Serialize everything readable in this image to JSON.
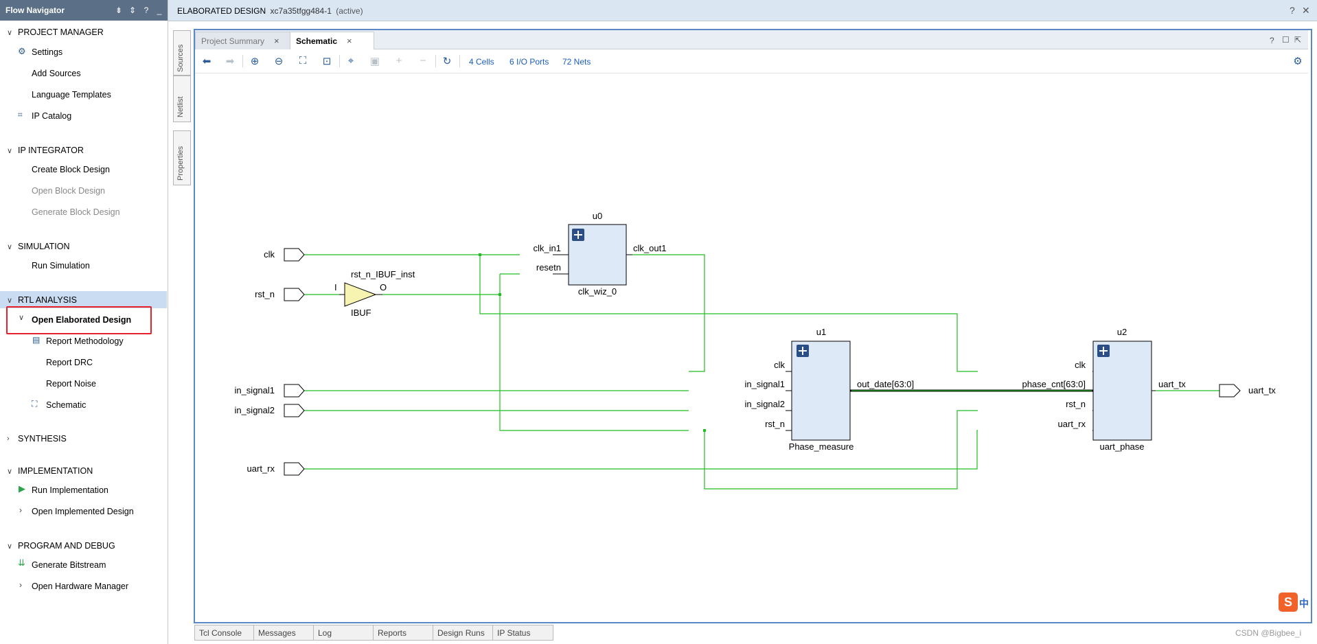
{
  "flow_navigator": {
    "title": "Flow Navigator",
    "sections": [
      {
        "title": "PROJECT MANAGER",
        "items": [
          {
            "label": "Settings",
            "icon": "gear-icon"
          },
          {
            "label": "Add Sources"
          },
          {
            "label": "Language Templates"
          },
          {
            "label": "IP Catalog",
            "icon": "ip-catalog-icon"
          }
        ]
      },
      {
        "title": "IP INTEGRATOR",
        "items": [
          {
            "label": "Create Block Design"
          },
          {
            "label": "Open Block Design",
            "disabled": true
          },
          {
            "label": "Generate Block Design",
            "disabled": true
          }
        ]
      },
      {
        "title": "SIMULATION",
        "items": [
          {
            "label": "Run Simulation"
          }
        ]
      },
      {
        "title": "RTL ANALYSIS",
        "items": [
          {
            "label": "Open Elaborated Design",
            "selected": true
          },
          {
            "label": "Report Methodology",
            "icon": "clipboard-icon"
          },
          {
            "label": "Report DRC"
          },
          {
            "label": "Report Noise"
          },
          {
            "label": "Schematic",
            "icon": "schematic-icon"
          }
        ]
      },
      {
        "title": "SYNTHESIS",
        "items": []
      },
      {
        "title": "IMPLEMENTATION",
        "items": [
          {
            "label": "Run Implementation",
            "icon": "play-icon"
          },
          {
            "label": "Open Implemented Design"
          }
        ]
      },
      {
        "title": "PROGRAM AND DEBUG",
        "items": [
          {
            "label": "Generate Bitstream",
            "icon": "bitstream-icon"
          },
          {
            "label": "Open Hardware Manager"
          }
        ]
      }
    ]
  },
  "title_bar": {
    "title": "ELABORATED DESIGN",
    "part": "xc7a35tfgg484-1",
    "status": "(active)"
  },
  "side_tabs": [
    "Sources",
    "Netlist",
    "Properties"
  ],
  "tabs": [
    {
      "label": "Project Summary",
      "active": false
    },
    {
      "label": "Schematic",
      "active": true
    }
  ],
  "toolbar": {
    "cells": "4 Cells",
    "io_ports": "6 I/O Ports",
    "nets": "72 Nets"
  },
  "schematic": {
    "ports": {
      "clk": "clk",
      "rst_n": "rst_n",
      "in_signal1": "in_signal1",
      "in_signal2": "in_signal2",
      "uart_rx": "uart_rx",
      "uart_tx": "uart_tx"
    },
    "ibuf": {
      "instance": "rst_n_IBUF_inst",
      "type": "IBUF",
      "pin_in": "I",
      "pin_out": "O"
    },
    "u0": {
      "instance": "u0",
      "type": "clk_wiz_0",
      "pin_clk_in1": "clk_in1",
      "pin_resetn": "resetn",
      "pin_clk_out1": "clk_out1"
    },
    "u1": {
      "instance": "u1",
      "type": "Phase_measure",
      "pin_clk": "clk",
      "pin_in_signal1": "in_signal1",
      "pin_in_signal2": "in_signal2",
      "pin_rst_n": "rst_n",
      "pin_out_date": "out_date[63:0]"
    },
    "u2": {
      "instance": "u2",
      "type": "uart_phase",
      "pin_clk": "clk",
      "pin_phase_cnt": "phase_cnt[63:0]",
      "pin_rst_n": "rst_n",
      "pin_uart_rx": "uart_rx",
      "pin_uart_tx": "uart_tx"
    }
  },
  "bottom_tabs": [
    "Tcl Console",
    "Messages",
    "Log",
    "Reports",
    "Design Runs",
    "IP Status"
  ],
  "watermark": "CSDN @Bigbee_i",
  "ime_label": "中"
}
